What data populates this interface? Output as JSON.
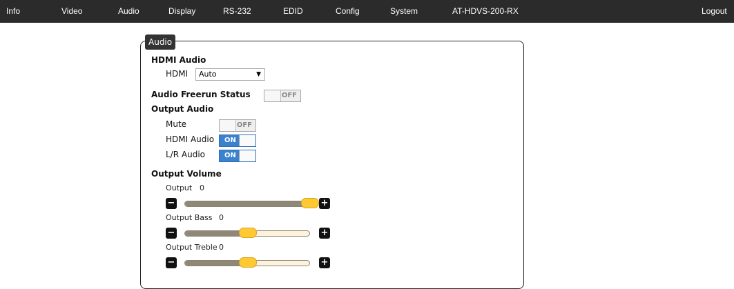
{
  "nav": {
    "items": [
      "Info",
      "Video",
      "Audio",
      "Display",
      "RS-232",
      "EDID",
      "Config",
      "System",
      "AT-HDVS-200-RX"
    ],
    "logout": "Logout"
  },
  "panel": {
    "legend": "Audio"
  },
  "hdmi_audio": {
    "heading": "HDMI Audio",
    "label": "HDMI",
    "selected": "Auto"
  },
  "freerun": {
    "label": "Audio Freerun Status",
    "state": "OFF"
  },
  "output_audio": {
    "heading": "Output Audio",
    "rows": [
      {
        "label": "Mute",
        "state": "OFF"
      },
      {
        "label": "HDMI Audio",
        "state": "ON"
      },
      {
        "label": "L/R Audio",
        "state": "ON"
      }
    ]
  },
  "output_volume": {
    "heading": "Output Volume",
    "sliders": [
      {
        "label": "Output",
        "value": "0",
        "fraction": 1.0
      },
      {
        "label": "Output Bass",
        "value": "0",
        "fraction": 0.5
      },
      {
        "label": "Output Treble",
        "value": "0",
        "fraction": 0.5
      }
    ]
  },
  "colors": {
    "nav_bg": "#2b2b2b",
    "toggle_on": "#3a82cf",
    "slider_handle": "#ffc934",
    "slider_fill": "#8f8877"
  }
}
